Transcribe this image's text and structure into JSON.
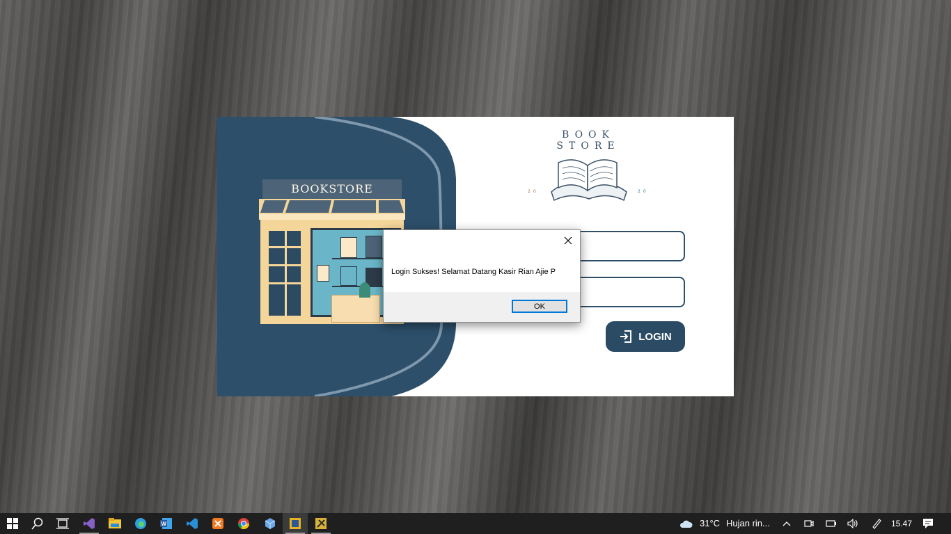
{
  "login_window": {
    "store_sign": "BOOKSTORE",
    "logo": {
      "title": "BOOK STORE",
      "year_left": "20",
      "year_right": "20"
    },
    "login_button_label": "LOGIN"
  },
  "dialog": {
    "message": "Login Sukses! Selamat Datang Kasir Rian Ajie P",
    "ok_label": "OK"
  },
  "taskbar": {
    "weather": {
      "temp": "31°C",
      "condition": "Hujan rin..."
    },
    "clock": "15.47",
    "pinned": [
      {
        "name": "visual-studio-icon",
        "color": "#8661c5"
      },
      {
        "name": "file-explorer-icon",
        "color": "#f4c534"
      },
      {
        "name": "edge-icon",
        "color": "#2ea0e0"
      },
      {
        "name": "word-icon",
        "color": "#2b5797"
      },
      {
        "name": "vscode-icon",
        "color": "#2b8fd6"
      },
      {
        "name": "xampp-icon",
        "color": "#f37a21"
      },
      {
        "name": "chrome-icon",
        "color": "#4caf50"
      },
      {
        "name": "box-app-icon",
        "color": "#6aa8e8"
      },
      {
        "name": "running-app-icon",
        "color": "#e6b422"
      },
      {
        "name": "netbeans-icon",
        "color": "#d8b23a"
      }
    ]
  },
  "colors": {
    "panel": "#2d4f6a",
    "accent": "#2b4a63",
    "focus": "#0078d7"
  }
}
